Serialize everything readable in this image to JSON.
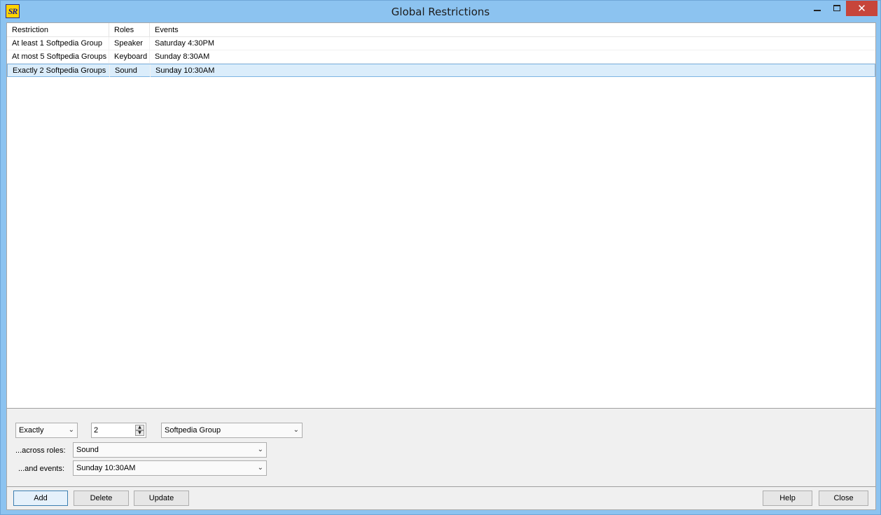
{
  "window": {
    "title": "Global Restrictions",
    "app_icon_text": "SR",
    "close_glyph": "✕"
  },
  "list": {
    "columns": [
      "Restriction",
      "Roles",
      "Events"
    ],
    "rows": [
      {
        "restriction": "At least 1 Softpedia Group",
        "roles": "Speaker",
        "events": "Saturday 4:30PM",
        "selected": false
      },
      {
        "restriction": "At most 5 Softpedia Groups",
        "roles": "Keyboard",
        "events": "Sunday 8:30AM",
        "selected": false
      },
      {
        "restriction": "Exactly 2 Softpedia Groups",
        "roles": "Sound",
        "events": "Sunday 10:30AM",
        "selected": true
      }
    ]
  },
  "editor": {
    "quantifier": "Exactly",
    "count": "2",
    "group": "Softpedia Group",
    "across_roles_label": "...across roles:",
    "roles_value": "Sound",
    "and_events_label": "...and events:",
    "events_value": "Sunday 10:30AM"
  },
  "buttons": {
    "add": "Add",
    "delete": "Delete",
    "update": "Update",
    "help": "Help",
    "close": "Close"
  },
  "icons": {
    "dropdown": "chevron-down-icon",
    "spin_up": "▲",
    "spin_down": "▼",
    "chevron": "⌄"
  }
}
